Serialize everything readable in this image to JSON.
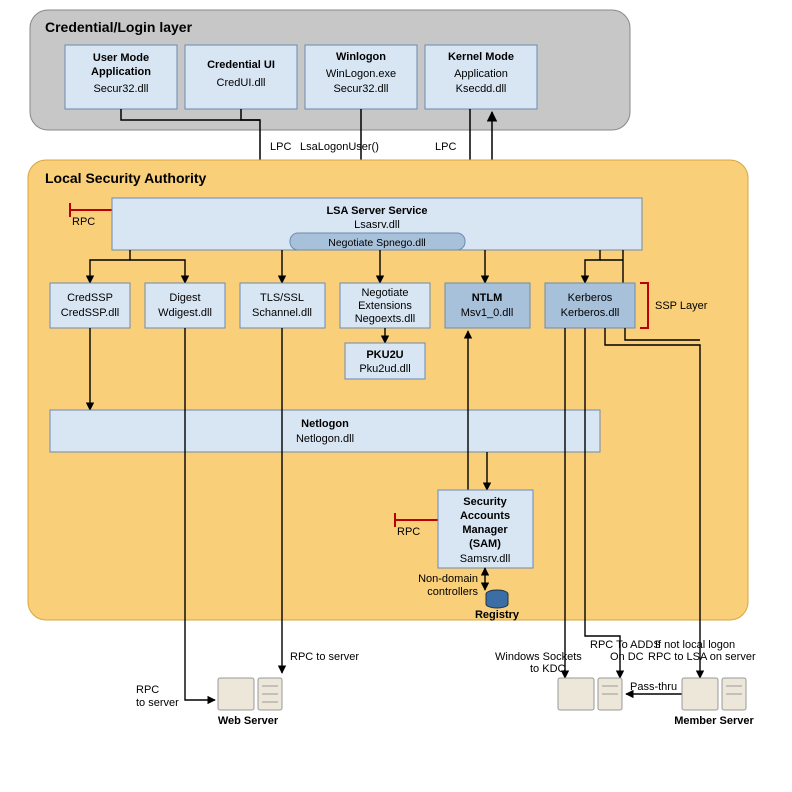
{
  "sections": {
    "credLayer": "Credential/Login layer",
    "lsa": "Local Security Authority"
  },
  "boxes": {
    "userMode": {
      "t": "User Mode",
      "t2": "Application",
      "s": "Secur32.dll"
    },
    "credUI": {
      "t": "Credential UI",
      "s": "CredUI.dll"
    },
    "winlogon": {
      "t": "Winlogon",
      "s1": "WinLogon.exe",
      "s2": "Secur32.dll"
    },
    "kernel": {
      "t": "Kernel Mode",
      "s1": "Application",
      "s2": "Ksecdd.dll"
    },
    "lsaServer": {
      "t": "LSA Server Service",
      "s": "Lsasrv.dll"
    },
    "negotiate": "Negotiate Spnego.dll",
    "credssp": {
      "t": "CredSSP",
      "s": "CredSSP.dll"
    },
    "digest": {
      "t": "Digest",
      "s": "Wdigest.dll"
    },
    "tls": {
      "t": "TLS/SSL",
      "s": "Schannel.dll"
    },
    "negoext": {
      "t": "Negotiate",
      "t2": "Extensions",
      "s": "Negoexts.dll"
    },
    "ntlm": {
      "t": "NTLM",
      "s": "Msv1_0.dll"
    },
    "kerberos": {
      "t": "Kerberos",
      "s": "Kerberos.dll"
    },
    "pku2u": {
      "t": "PKU2U",
      "s": "Pku2ud.dll"
    },
    "netlogon": {
      "t": "Netlogon",
      "s": "Netlogon.dll"
    },
    "sam": {
      "t": "Security",
      "t2": "Accounts",
      "t3": "Manager",
      "t4": "(SAM)",
      "s": "Samsrv.dll"
    }
  },
  "labels": {
    "lpc1": "LPC",
    "lsalogon": "LsaLogonUser()",
    "lpc2": "LPC",
    "rpc1": "RPC",
    "rpc2": "RPC",
    "sspLayer": "SSP Layer",
    "nondc": "Non-domain",
    "nondc2": "controllers",
    "registry": "Registry",
    "rpcServer": "RPC to server",
    "rpcServer2": "RPC",
    "rpcServer2b": "to server",
    "webServer": "Web Server",
    "winsock": "Windows Sockets",
    "winsock2": "to KDC",
    "rpcAdds": "RPC To ADDS",
    "rpcAdds2": "On DC",
    "ifnot": "If not local logon",
    "ifnot2": "RPC to LSA  on server",
    "passthru": "Pass-thru",
    "memberServer": "Member Server"
  }
}
